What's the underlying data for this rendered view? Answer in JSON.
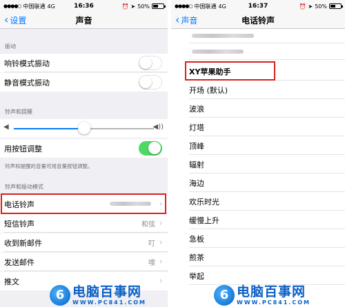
{
  "left": {
    "status": {
      "carrier": "中国联通",
      "network": "4G",
      "time": "16:36",
      "battery": "50%"
    },
    "nav": {
      "back": "设置",
      "title": "声音"
    },
    "sections": {
      "vibration": "振动",
      "ringer": "铃声和提醒",
      "ringer_note": "铃声和提醒的音量可用音量按钮调整。",
      "patterns": "铃声和振动模式"
    },
    "rows": {
      "ring_vibrate": "响铃模式振动",
      "silent_vibrate": "静音模式振动",
      "change_with_buttons": "用按钮调整",
      "ringtone": "电话铃声",
      "text_tone": "短信铃声",
      "text_tone_value": "和弦",
      "new_mail": "收到新邮件",
      "new_mail_value": "叮",
      "sent_mail": "发送邮件",
      "sent_mail_value": "嗖",
      "tweet": "推文"
    },
    "volume_level": 0.5
  },
  "right": {
    "status": {
      "carrier": "中国联通",
      "network": "4G",
      "time": "16:37",
      "battery": "50%"
    },
    "nav": {
      "back": "声音",
      "title": "电话铃声"
    },
    "tones": [
      "XY苹果助手",
      "开场 (默认)",
      "波浪",
      "灯塔",
      "顶峰",
      "辐射",
      "海边",
      "欢乐时光",
      "缓慢上升",
      "急板",
      "煎茶",
      "举起"
    ]
  },
  "watermark": {
    "name": "电脑百事网",
    "url": "WWW.PC841.COM",
    "logo_letter": "6"
  },
  "colors": {
    "accent": "#007aff",
    "toggle_on": "#4cd964",
    "highlight": "#d81e1e"
  }
}
